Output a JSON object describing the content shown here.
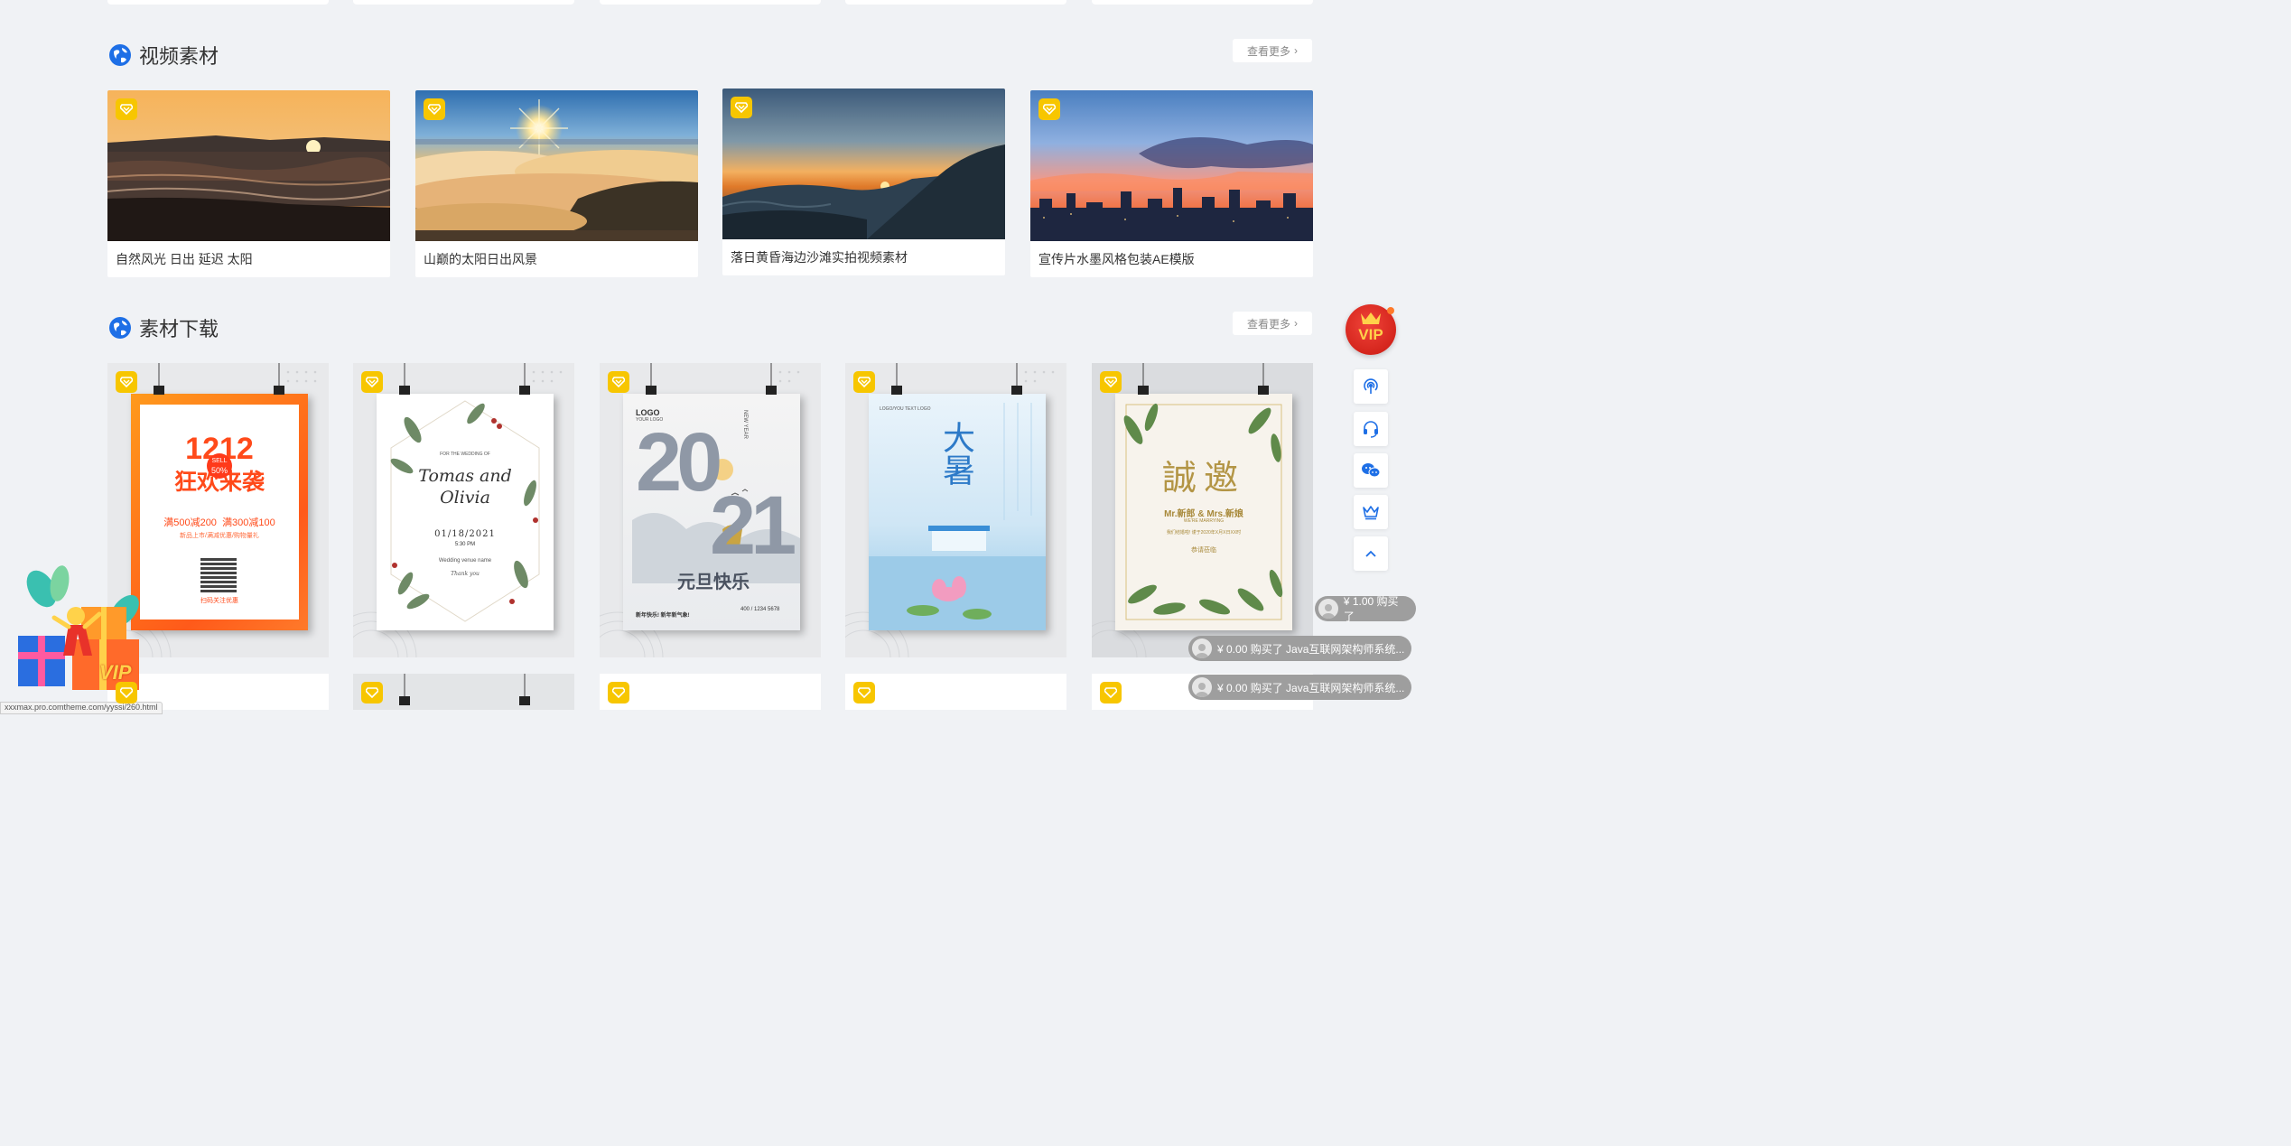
{
  "sections": {
    "video": {
      "title": "视频素材",
      "more": "查看更多"
    },
    "material": {
      "title": "素材下载",
      "more": "查看更多"
    }
  },
  "videos": [
    {
      "caption": "自然风光 日出 延迟 太阳"
    },
    {
      "caption": "山巅的太阳日出风景"
    },
    {
      "caption": "落日黄昏海边沙滩实拍视频素材"
    },
    {
      "caption": "宣传片水墨风格包装AE模版"
    }
  ],
  "posters": {
    "p1": {
      "big1": "1212",
      "big2": "狂欢来袭",
      "sell": "SELL",
      "pct": "50%",
      "offer1": "满500减200",
      "offer2": "满300减100",
      "line": "新品上市/满减优惠/购物量礼",
      "footer": "扫码关注优惠"
    },
    "p2": {
      "small": "FOR THE WEDDING OF",
      "name1": "Tomas and",
      "name2": "Olivia",
      "date": "01/18/2021",
      "time": "5:30 PM",
      "venue": "Wedding venue name",
      "thanks": "Thank you"
    },
    "p3": {
      "logo": "LOGO",
      "logo_sub": "YOUR LOGO",
      "newyear": "NEW YEAR",
      "year_l": "20",
      "year_r": "21",
      "caption": "元旦快乐",
      "footer": "新年快乐! 新年新气象!",
      "phone": "400 / 1234 5678"
    },
    "p4": {
      "title": "大暑",
      "brand": "LOGO/YOU TEXT LOGO"
    },
    "p5": {
      "title": "誠邀",
      "names": "Mr.新郎 & Mrs.新娘",
      "sub": "WE'RE MARRYING",
      "line": "我们结婚啦! 谨于2020年X月X日XX时",
      "foot": "恭请莅临"
    }
  },
  "tickers": [
    {
      "text": "¥ 1.00 购买了"
    },
    {
      "text": "¥ 0.00 购买了 Java互联网架构师系统..."
    },
    {
      "text": "¥ 0.00 购买了 Java互联网架构师系统..."
    }
  ],
  "vip": {
    "label": "VIP"
  },
  "floating_vip": {
    "label": "VIP"
  },
  "status_url": "xxxmax.pro.comtheme.com/yyssi/260.html",
  "colors": {
    "accent_blue": "#1e6fe6",
    "badge_gold": "#f7c600",
    "vip_red": "#d8221a",
    "ticker_gray": "#9e9e9e"
  }
}
